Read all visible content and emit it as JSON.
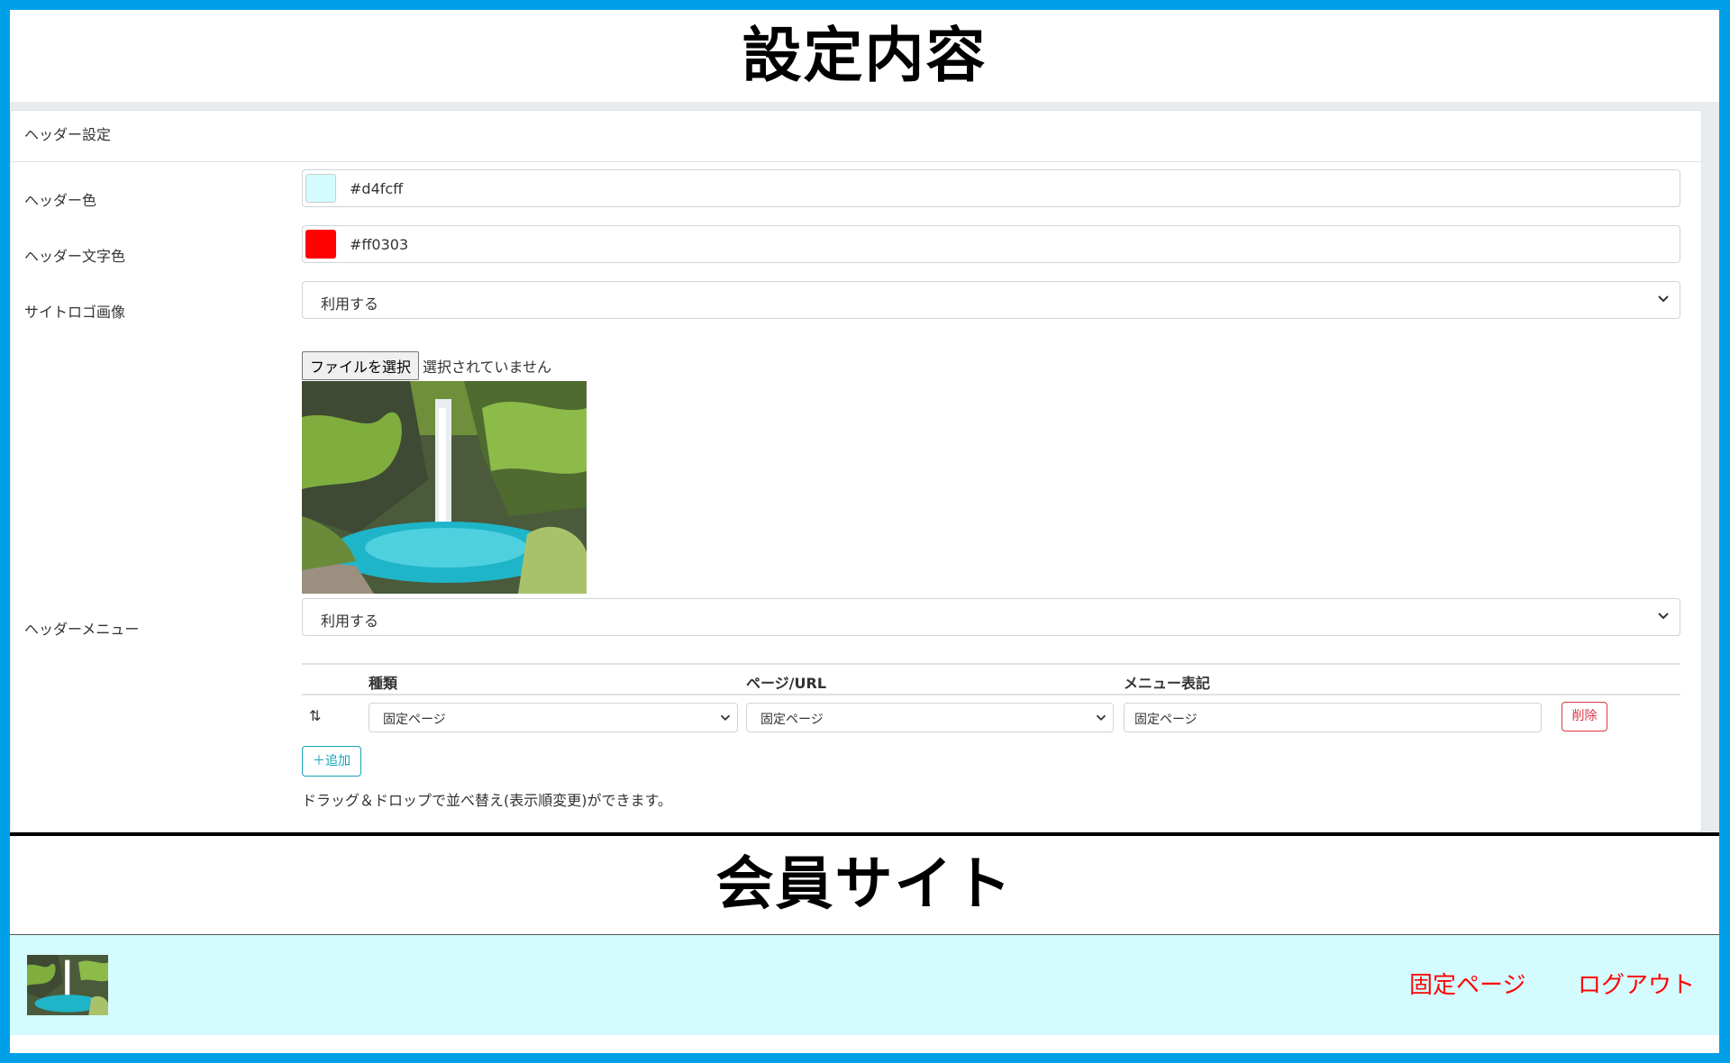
{
  "titles": {
    "settings": "設定内容",
    "member_site": "会員サイト"
  },
  "card": {
    "header": "ヘッダー設定"
  },
  "fields": {
    "header_color": {
      "label": "ヘッダー色",
      "value": "#d4fcff",
      "swatch": "#d4fcff"
    },
    "header_text_color": {
      "label": "ヘッダー文字色",
      "value": "#ff0303",
      "swatch": "#ff0303"
    },
    "site_logo": {
      "label": "サイトロゴ画像",
      "selected": "利用する"
    },
    "file": {
      "button": "ファイルを選択",
      "status": "選択されていません"
    },
    "header_menu": {
      "label": "ヘッダーメニュー",
      "selected": "利用する"
    }
  },
  "menu_table": {
    "headers": [
      "種類",
      "ページ/URL",
      "メニュー表記"
    ],
    "rows": [
      {
        "handle": "⇅",
        "type": "固定ページ",
        "page": "固定ページ",
        "label": "固定ページ",
        "delete": "削除"
      }
    ],
    "add_button": "＋追加",
    "help": "ドラッグ＆ドロップで並べ替え(表示順変更)ができます。"
  },
  "site_header": {
    "background": "#d4fcff",
    "text_color": "#ff0303",
    "nav": [
      "固定ページ",
      "ログアウト"
    ]
  },
  "icons": {
    "select_arrow": "chevron-down-icon",
    "drag": "drag-handle-icon"
  }
}
